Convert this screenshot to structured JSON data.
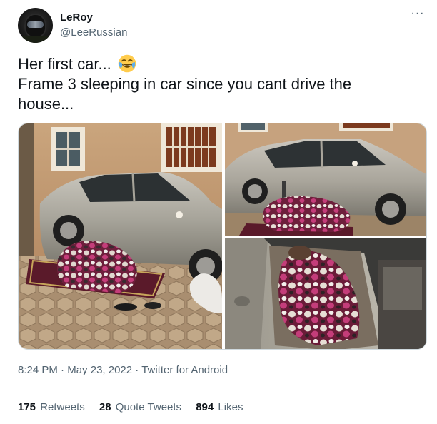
{
  "author": {
    "display_name": "LeRoy",
    "handle": "@LeeRussian"
  },
  "tweet": {
    "line1": "Her first car... ",
    "emoji": "face-with-tears-of-joy",
    "line2": "Frame 3 sleeping in car since you cant drive the",
    "line3": "house..."
  },
  "media": {
    "photos": [
      "photo-car-blanket-outside",
      "photo-car-side",
      "photo-car-window-sleeping"
    ]
  },
  "meta": {
    "time": "8:24 PM",
    "sep": " · ",
    "date": "May 23, 2022",
    "source": "Twitter for Android"
  },
  "stats": {
    "retweets_count": "175",
    "retweets_label": "Retweets",
    "quotes_count": "28",
    "quotes_label": "Quote Tweets",
    "likes_count": "894",
    "likes_label": "Likes"
  },
  "colors": {
    "text": "#0f1419",
    "secondary": "#536471",
    "border": "#cfd9de"
  }
}
